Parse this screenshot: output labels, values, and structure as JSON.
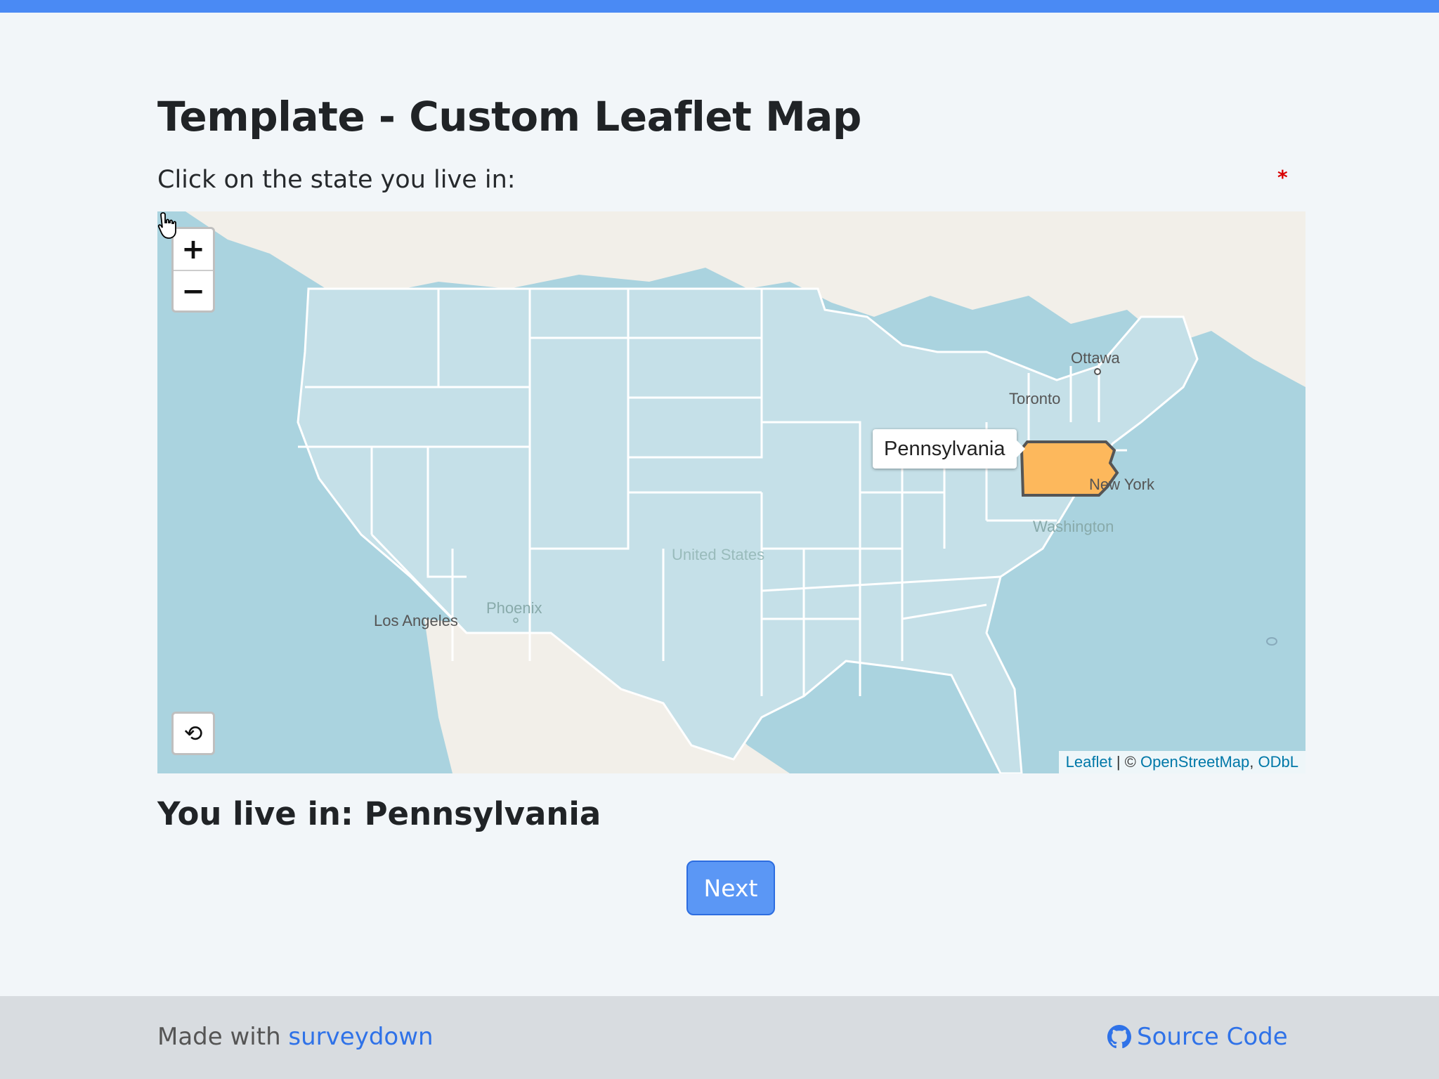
{
  "page": {
    "title": "Template - Custom Leaflet Map",
    "prompt": "Click on the state you live in:",
    "required_mark": "*",
    "answer": "You live in: Pennsylvania",
    "next_label": "Next"
  },
  "map": {
    "zoom_in": "+",
    "zoom_out": "−",
    "reset": "⟲",
    "tooltip": "Pennsylvania",
    "selected_state": "Pennsylvania",
    "colors": {
      "water": "#aad3df",
      "land": "#f2efe9",
      "state_fill": "#c5e0e8",
      "state_border": "#ffffff",
      "selected_fill": "#fdb85c",
      "selected_border": "#555555"
    },
    "labels": {
      "ottawa": "Ottawa",
      "toronto": "Toronto",
      "new_york": "New York",
      "washington": "Washington",
      "united_states": "United States",
      "phoenix": "Phoenix",
      "los_angeles": "Los Angeles"
    },
    "attribution": {
      "leaflet": "Leaflet",
      "separator": " | © ",
      "osm": "OpenStreetMap",
      "comma": ", ",
      "odbl": "ODbL"
    }
  },
  "footer": {
    "made_with": "Made with ",
    "surveydown": "surveydown",
    "source_code": "Source Code"
  }
}
